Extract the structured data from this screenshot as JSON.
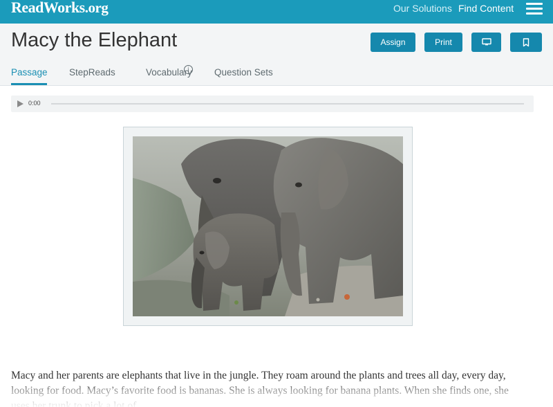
{
  "brand": {
    "logo_text": "ReadWorks",
    "logo_suffix": ".org"
  },
  "nav": {
    "solutions": "Our Solutions",
    "find_content": "Find Content",
    "menu_icon": "hamburger-menu-icon"
  },
  "colors": {
    "top_bar": "#1b9bbb",
    "button": "#1588ad",
    "active_tab": "#1a8fb3"
  },
  "page": {
    "title": "Macy the Elephant"
  },
  "actions": {
    "assign_label": "Assign",
    "print_label": "Print",
    "present_icon": "monitor-icon",
    "bookmark_icon": "bookmark-icon"
  },
  "tabs": {
    "passage": "Passage",
    "stepreads": "StepReads",
    "stepreads_info": "i",
    "vocabulary": "Vocabulary",
    "question_sets": "Question Sets"
  },
  "audio": {
    "time": "0:00",
    "play_icon": "play-icon"
  },
  "passage": {
    "text": "Macy and her parents are elephants that live in the jungle. They roam around the plants and trees all day, every day, looking for food. Macy’s favorite food is bananas. She is always looking for banana plants. When she finds one, she uses her trunk to pick a lot of"
  }
}
